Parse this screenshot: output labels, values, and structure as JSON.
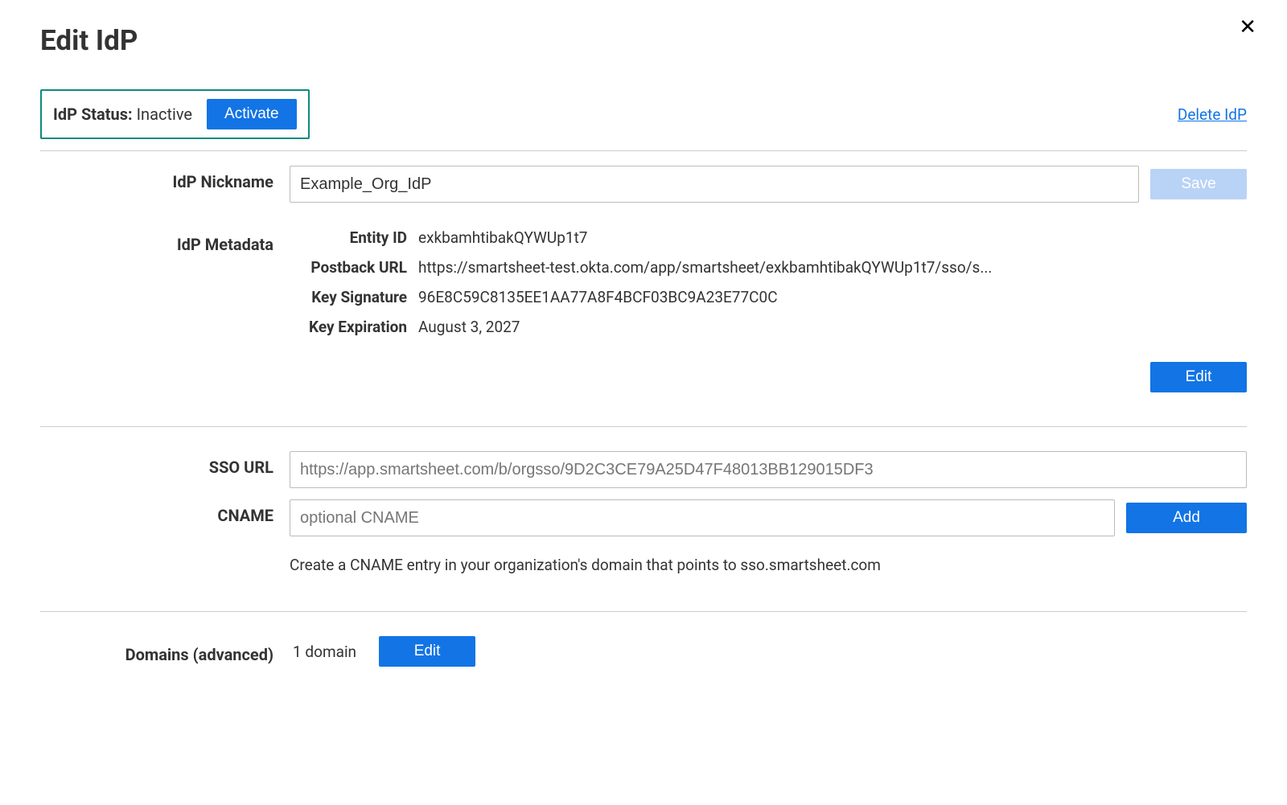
{
  "header": {
    "title": "Edit IdP",
    "close_label": "✕"
  },
  "status": {
    "label": "IdP Status:",
    "value": "Inactive",
    "activate_button": "Activate",
    "delete_link": "Delete IdP"
  },
  "nickname": {
    "label": "IdP Nickname",
    "value": "Example_Org_IdP",
    "save_button": "Save"
  },
  "metadata": {
    "label": "IdP Metadata",
    "entity_id_label": "Entity ID",
    "entity_id_value": "exkbamhtibakQYWUp1t7",
    "postback_label": "Postback URL",
    "postback_value": "https://smartsheet-test.okta.com/app/smartsheet/exkbamhtibakQYWUp1t7/sso/s...",
    "key_sig_label": "Key Signature",
    "key_sig_value": "96E8C59C8135EE1AA77A8F4BCF03BC9A23E77C0C",
    "key_exp_label": "Key Expiration",
    "key_exp_value": "August 3, 2027",
    "edit_button": "Edit"
  },
  "sso": {
    "url_label": "SSO URL",
    "url_value": "https://app.smartsheet.com/b/orgsso/9D2C3CE79A25D47F48013BB129015DF3",
    "cname_label": "CNAME",
    "cname_placeholder": "optional CNAME",
    "add_button": "Add",
    "cname_help": "Create a CNAME entry in your organization's domain that points to sso.smartsheet.com"
  },
  "domains": {
    "label": "Domains (advanced)",
    "count": "1 domain",
    "edit_button": "Edit"
  }
}
